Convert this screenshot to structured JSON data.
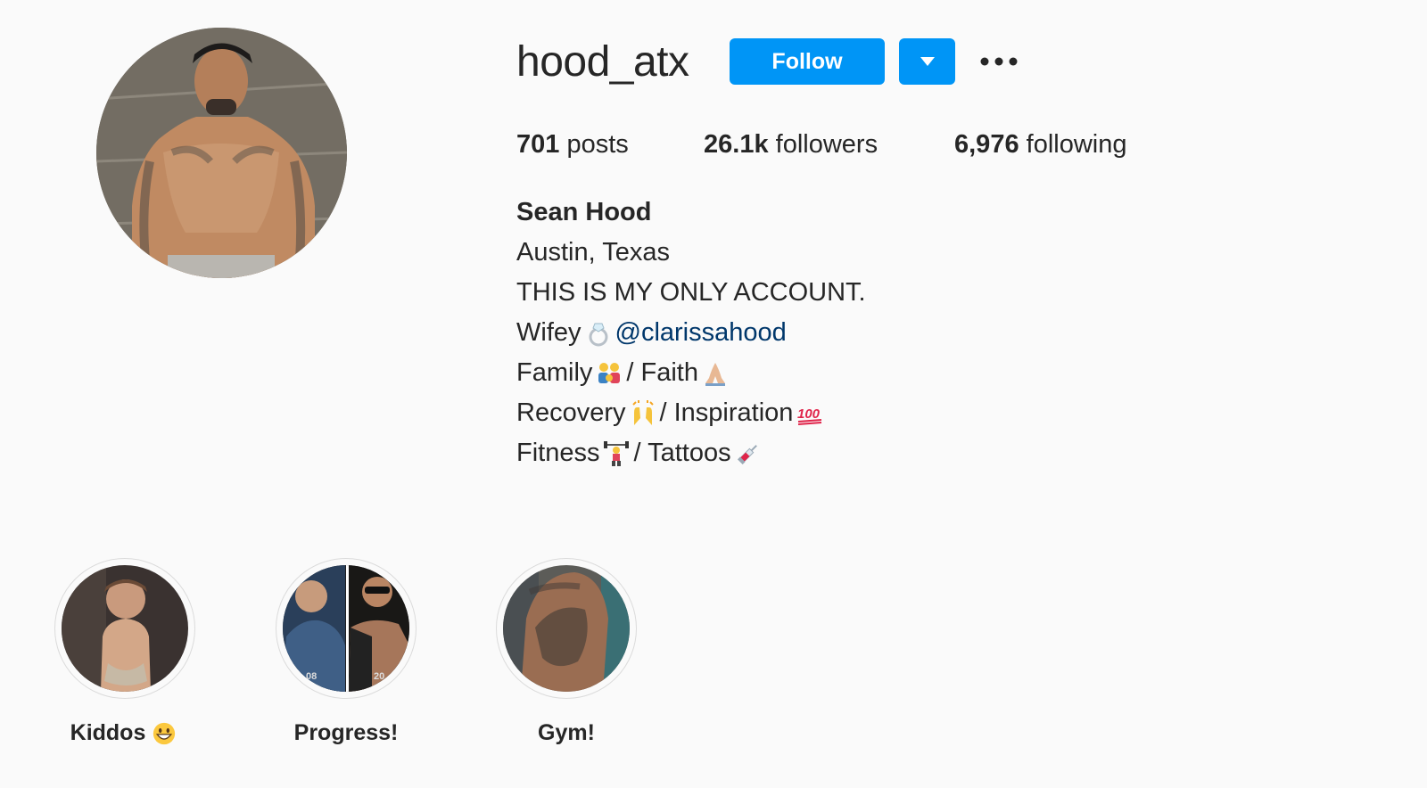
{
  "profile": {
    "username": "hood_atx",
    "follow_label": "Follow",
    "colors": {
      "accent": "#0095f6",
      "mention": "#00376b",
      "text": "#262626",
      "background": "#fafafa"
    }
  },
  "stats": {
    "posts_count": "701",
    "posts_label": "posts",
    "followers_count": "26.1k",
    "followers_label": "followers",
    "following_count": "6,976",
    "following_label": "following"
  },
  "bio": {
    "full_name": "Sean Hood",
    "location": "Austin, Texas",
    "line_account": "THIS IS MY ONLY ACCOUNT.",
    "wifey_prefix": "Wifey",
    "wifey_mention": "@clarissahood",
    "family": "Family",
    "faith": "/ Faith",
    "recovery": "Recovery",
    "inspiration": "/ Inspiration",
    "fitness": "Fitness",
    "tattoos": "/ Tattoos"
  },
  "icons": {
    "more": "more-horizontal-icon",
    "dropdown": "caret-down-icon",
    "emoji": [
      "ring-emoji-icon",
      "family-emoji-icon",
      "praying-hands-emoji-icon",
      "raising-hands-emoji-icon",
      "hundred-points-emoji-icon",
      "weight-lifter-emoji-icon",
      "syringe-emoji-icon",
      "grinning-face-emoji-icon"
    ]
  },
  "highlights": [
    {
      "label": "Kiddos"
    },
    {
      "label": "Progress!",
      "cover_text_left": "08",
      "cover_text_right": "20"
    },
    {
      "label": "Gym!"
    }
  ]
}
